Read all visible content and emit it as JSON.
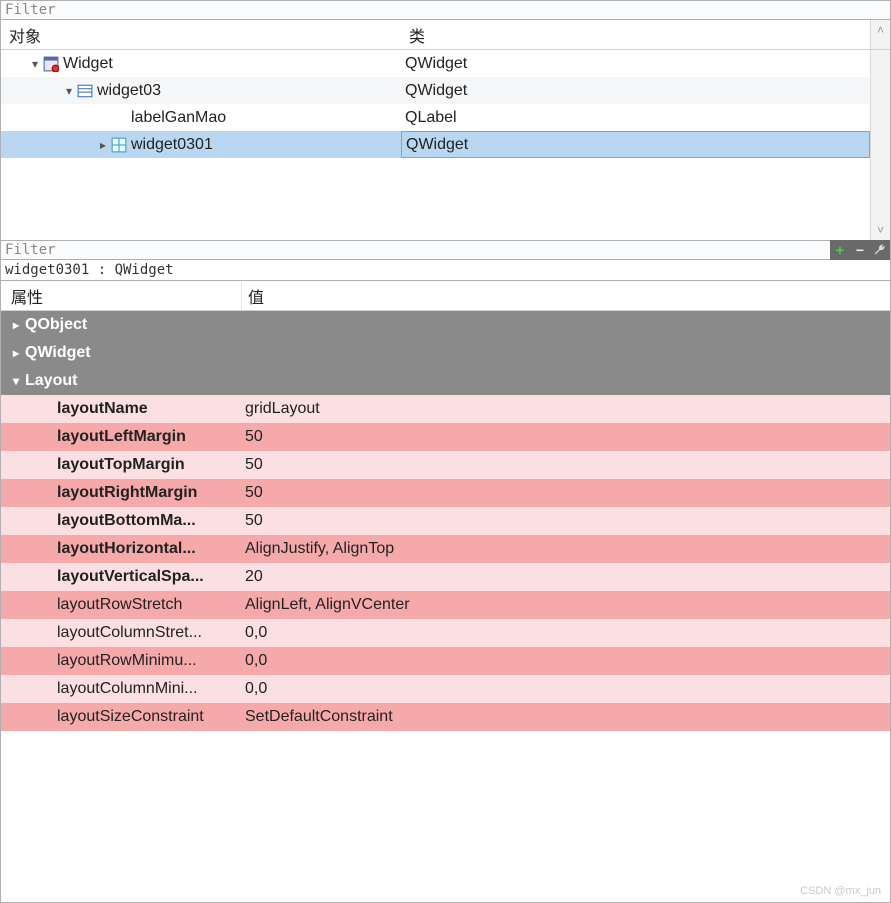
{
  "topFilter": {
    "placeholder": "Filter"
  },
  "treeHeader": {
    "object": "对象",
    "class": "类"
  },
  "tree": {
    "rows": [
      {
        "indent": 0,
        "exp": "▾",
        "iconType": "widget",
        "name": "Widget",
        "cls": "QWidget",
        "striped": false,
        "selected": false
      },
      {
        "indent": 1,
        "exp": "▾",
        "iconType": "container",
        "name": "widget03",
        "cls": "QWidget",
        "striped": true,
        "selected": false
      },
      {
        "indent": 2,
        "exp": "",
        "iconType": "none",
        "name": "labelGanMao",
        "cls": "QLabel",
        "striped": false,
        "selected": false
      },
      {
        "indent": 2,
        "exp": "▸",
        "iconType": "grid",
        "name": "widget0301",
        "cls": "QWidget",
        "striped": false,
        "selected": true
      }
    ]
  },
  "propFilter": {
    "placeholder": "Filter"
  },
  "toolbar": {
    "plus": "+",
    "minus": "−",
    "wrench": "wrench"
  },
  "objectLine": "widget0301 : QWidget",
  "propHeader": {
    "name": "属性",
    "value": "值"
  },
  "groups": {
    "g0": {
      "label": "QObject",
      "exp": "▸"
    },
    "g1": {
      "label": "QWidget",
      "exp": "▸"
    },
    "g2": {
      "label": "Layout",
      "exp": "▾"
    }
  },
  "props": [
    {
      "name": "layoutName",
      "value": "gridLayout",
      "bold": true,
      "shade": "a"
    },
    {
      "name": "layoutLeftMargin",
      "value": "50",
      "bold": true,
      "shade": "b"
    },
    {
      "name": "layoutTopMargin",
      "value": "50",
      "bold": true,
      "shade": "a"
    },
    {
      "name": "layoutRightMargin",
      "value": "50",
      "bold": true,
      "shade": "b"
    },
    {
      "name": "layoutBottomMa...",
      "value": "50",
      "bold": true,
      "shade": "a"
    },
    {
      "name": "layoutHorizontal...",
      "value": "AlignJustify, AlignTop",
      "bold": true,
      "shade": "b"
    },
    {
      "name": "layoutVerticalSpa...",
      "value": "20",
      "bold": true,
      "shade": "a"
    },
    {
      "name": "layoutRowStretch",
      "value": "AlignLeft, AlignVCenter",
      "bold": false,
      "shade": "b"
    },
    {
      "name": "layoutColumnStret...",
      "value": "0,0",
      "bold": false,
      "shade": "a"
    },
    {
      "name": "layoutRowMinimu...",
      "value": "0,0",
      "bold": false,
      "shade": "b"
    },
    {
      "name": "layoutColumnMini...",
      "value": "0,0",
      "bold": false,
      "shade": "a"
    },
    {
      "name": "layoutSizeConstraint",
      "value": "SetDefaultConstraint",
      "bold": false,
      "shade": "b"
    }
  ],
  "watermark": "CSDN @mx_jun"
}
